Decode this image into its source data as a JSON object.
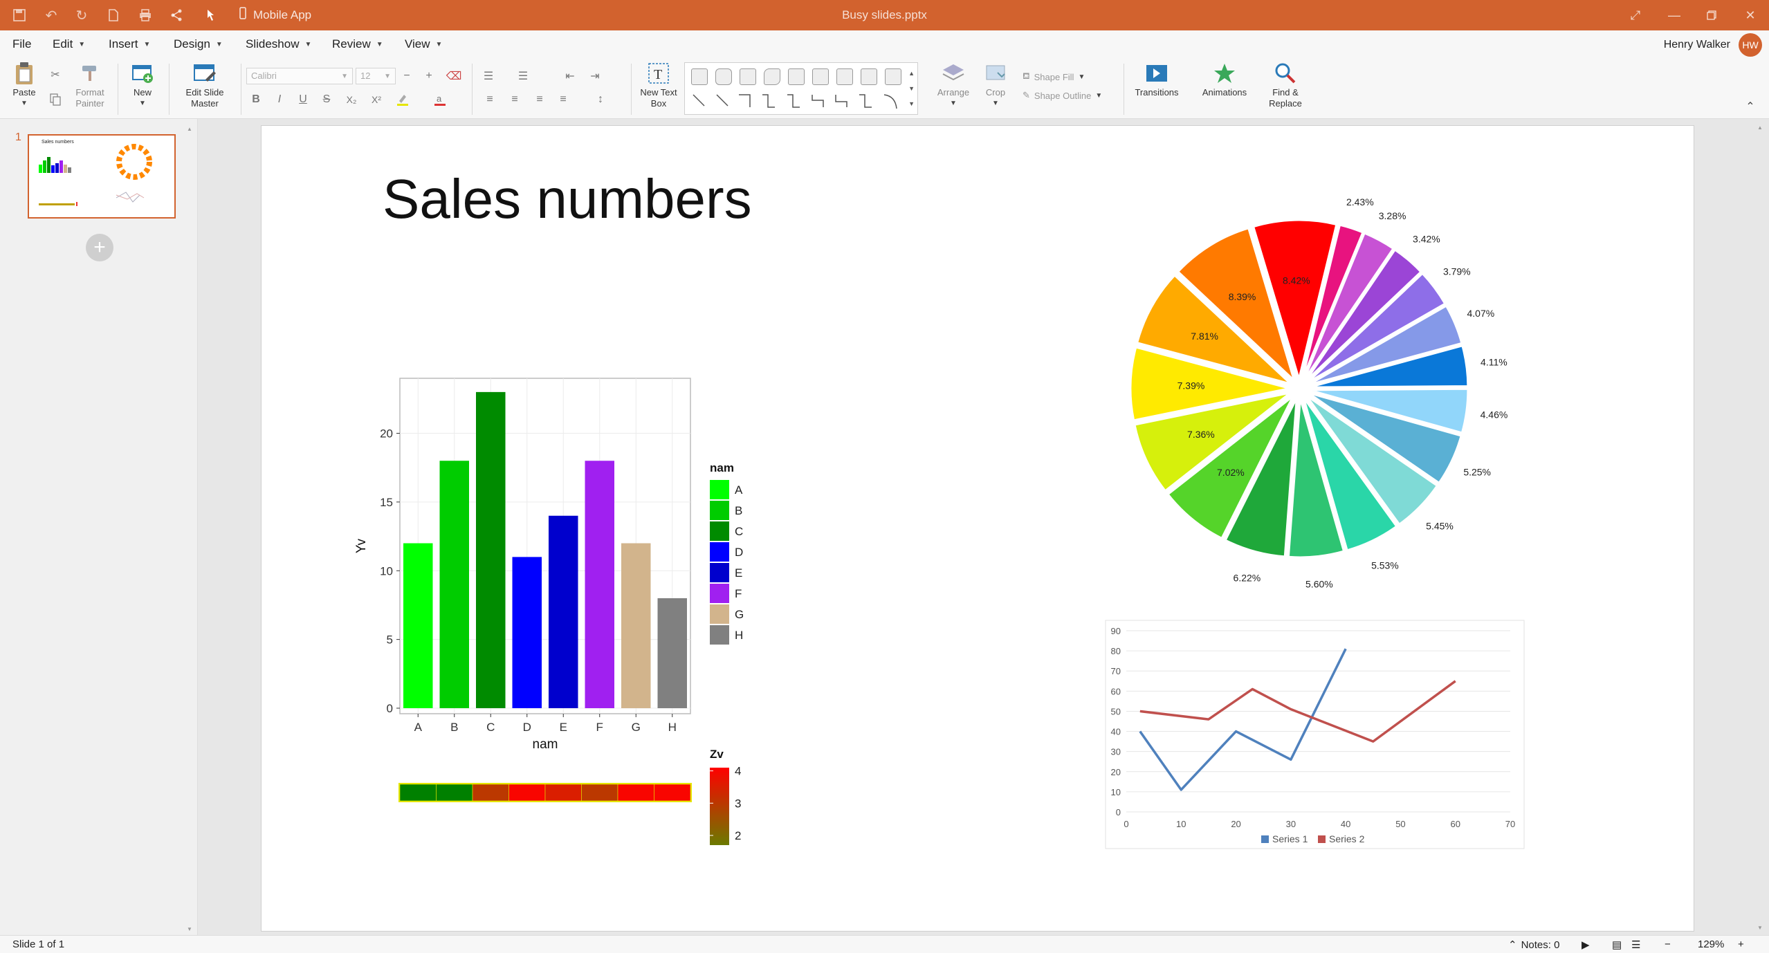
{
  "titlebar": {
    "document_title": "Busy slides.pptx",
    "mobile_app_label": "Mobile App",
    "background": "#d2622e"
  },
  "menubar": {
    "items": [
      {
        "label": "File",
        "has_dropdown": false
      },
      {
        "label": "Edit",
        "has_dropdown": true
      },
      {
        "label": "Insert",
        "has_dropdown": true
      },
      {
        "label": "Design",
        "has_dropdown": true
      },
      {
        "label": "Slideshow",
        "has_dropdown": true
      },
      {
        "label": "Review",
        "has_dropdown": true
      },
      {
        "label": "View",
        "has_dropdown": true
      }
    ],
    "user_name": "Henry Walker"
  },
  "ribbon": {
    "paste": "Paste",
    "format_painter": "Format Painter",
    "new": "New",
    "edit_slide_master": "Edit Slide Master",
    "font_name": "Calibri",
    "font_size": "12",
    "new_text_box": "New Text Box",
    "arrange": "Arrange",
    "crop": "Crop",
    "shape_fill": "Shape Fill",
    "shape_outline": "Shape Outline",
    "transitions": "Transitions",
    "animations": "Animations",
    "find_replace": "Find & Replace"
  },
  "thumbnails": [
    {
      "number": "1",
      "title": "Sales numbers"
    }
  ],
  "slide": {
    "title": "Sales numbers"
  },
  "chart_data": [
    {
      "type": "bar",
      "categories": [
        "A",
        "B",
        "C",
        "D",
        "E",
        "F",
        "G",
        "H"
      ],
      "values": [
        12,
        18,
        23,
        11,
        14,
        18,
        12,
        8
      ],
      "colors": [
        "#00ff00",
        "#00cc00",
        "#008b00",
        "#0000ff",
        "#0000cd",
        "#a020f0",
        "#d2b48c",
        "#808080"
      ],
      "xlabel": "nam",
      "ylabel": "Yv",
      "yticks": [
        0,
        5,
        10,
        15,
        20
      ],
      "ylim": [
        0,
        24
      ],
      "grid": true,
      "legend": {
        "title": "nam",
        "placement": "right",
        "entries": [
          "A",
          "B",
          "C",
          "D",
          "E",
          "F",
          "G",
          "H"
        ]
      }
    },
    {
      "type": "heatmap",
      "categories": [
        "A",
        "B",
        "C",
        "D",
        "E",
        "F",
        "G",
        "H"
      ],
      "values": [
        2,
        2,
        3,
        4,
        3.5,
        3,
        4,
        4
      ],
      "colorbar": {
        "title": "Zv",
        "ticks": [
          2,
          3,
          4
        ],
        "range": [
          1.7,
          4.1
        ],
        "low_color": "#6b7a00",
        "high_color": "#ff0000"
      }
    },
    {
      "type": "pie",
      "exploded": true,
      "slices": [
        {
          "value": 8.42,
          "label": "8.42%",
          "color": "#ff0000"
        },
        {
          "value": 2.43,
          "label": "2.43%",
          "color": "#e8137f"
        },
        {
          "value": 3.28,
          "label": "3.28%",
          "color": "#c752d4"
        },
        {
          "value": 3.42,
          "label": "3.42%",
          "color": "#9b45d6"
        },
        {
          "value": 3.79,
          "label": "3.79%",
          "color": "#8e6ee8"
        },
        {
          "value": 4.07,
          "label": "4.07%",
          "color": "#8599e8"
        },
        {
          "value": 4.11,
          "label": "4.11%",
          "color": "#0a78d8"
        },
        {
          "value": 4.46,
          "label": "4.46%",
          "color": "#91d6fa"
        },
        {
          "value": 5.25,
          "label": "5.25%",
          "color": "#5ab0d4"
        },
        {
          "value": 5.45,
          "label": "5.45%",
          "color": "#7fdad6"
        },
        {
          "value": 5.53,
          "label": "5.53%",
          "color": "#2ad6a8"
        },
        {
          "value": 5.6,
          "label": "5.60%",
          "color": "#2ec472"
        },
        {
          "value": 6.22,
          "label": "6.22%",
          "color": "#1fa83a"
        },
        {
          "value": 7.02,
          "label": "7.02%",
          "color": "#55d42a"
        },
        {
          "value": 7.36,
          "label": "7.36%",
          "color": "#d6f00c"
        },
        {
          "value": 7.39,
          "label": "7.39%",
          "color": "#ffea00"
        },
        {
          "value": 7.81,
          "label": "7.81%",
          "color": "#ffaa00"
        },
        {
          "value": 8.39,
          "label": "8.39%",
          "color": "#ff7a00"
        }
      ]
    },
    {
      "type": "line",
      "xlim": [
        0,
        70
      ],
      "ylim": [
        0,
        90
      ],
      "xticks": [
        0,
        10,
        20,
        30,
        40,
        50,
        60,
        70
      ],
      "yticks": [
        0,
        10,
        20,
        30,
        40,
        50,
        60,
        70,
        80,
        90
      ],
      "grid": true,
      "legend": {
        "placement": "bottom"
      },
      "series": [
        {
          "name": "Series 1",
          "color": "#4f81bd",
          "x": [
            2.5,
            10,
            20,
            30,
            40
          ],
          "y": [
            40,
            11,
            40,
            26,
            81
          ]
        },
        {
          "name": "Series 2",
          "color": "#c0504d",
          "x": [
            2.5,
            15,
            23,
            30,
            45,
            60
          ],
          "y": [
            50,
            46,
            61,
            51,
            35,
            65
          ]
        }
      ]
    }
  ],
  "statusbar": {
    "slide_info": "Slide 1 of 1",
    "notes": "Notes: 0",
    "zoom": "129%"
  }
}
